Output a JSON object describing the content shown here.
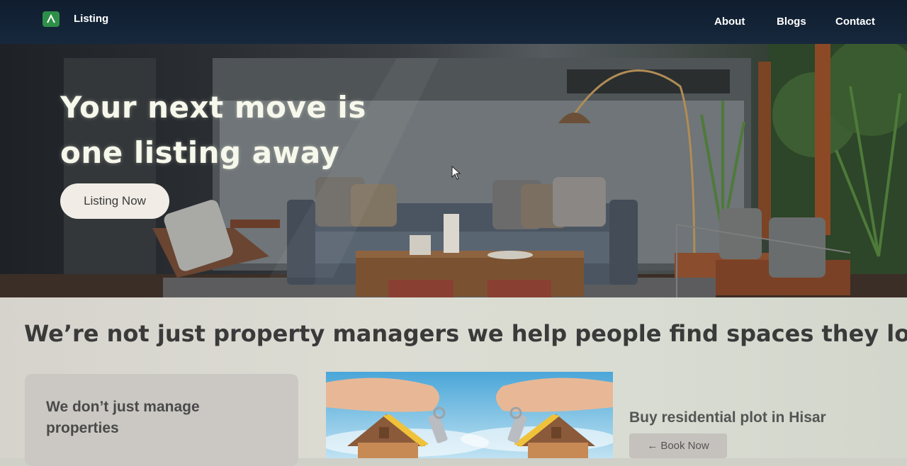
{
  "brand": {
    "name": "Listing",
    "logo_icon": "chevron-up-icon",
    "logo_color": "#2e8f48"
  },
  "nav": {
    "links": [
      "About",
      "Blogs",
      "Contact"
    ]
  },
  "hero": {
    "title_line1": "Your next move is",
    "title_line2": "one listing away",
    "cta_label": "Listing Now"
  },
  "section": {
    "headline": "We’re not just property managers we help people find spaces they love.",
    "card": {
      "title": "We don’t just manage properties"
    },
    "promo": {
      "title": "Buy residential plot in Hisar",
      "button_label": "Book Now",
      "button_icon": "arrow-left-icon"
    }
  }
}
